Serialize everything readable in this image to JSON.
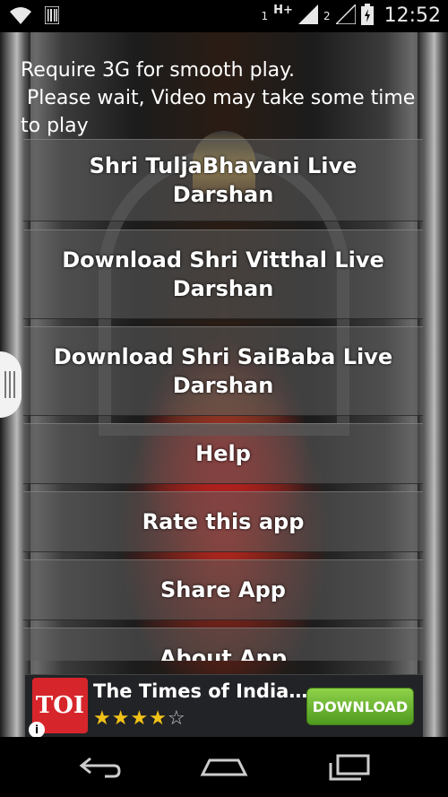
{
  "status_bar": {
    "sim1_label": "1",
    "network_type": "H+",
    "sim2_label": "2",
    "time": "12:52",
    "icons": [
      "wifi-icon",
      "barcode-icon",
      "signal-icon",
      "signal-icon",
      "battery-icon"
    ]
  },
  "notice": {
    "text": "Require 3G for smooth play.\n Please wait, Video may take some time to play"
  },
  "menu": {
    "items": [
      {
        "label": "Shri TuljaBhavani Live Darshan"
      },
      {
        "label": "Download Shri Vitthal Live Darshan"
      },
      {
        "label": "Download Shri SaiBaba Live Darshan"
      },
      {
        "label": "Help"
      },
      {
        "label": "Rate this app"
      },
      {
        "label": "Share App"
      },
      {
        "label": "About App"
      }
    ]
  },
  "ad": {
    "logo_text": "TOI",
    "title": "The Times of India…",
    "rating": 4,
    "rating_max": 5,
    "cta_label": "DOWNLOAD",
    "info_label": "i",
    "brand_color": "#d6262b"
  },
  "nav_bar": {
    "icons": [
      "back-icon",
      "home-icon",
      "recents-icon"
    ]
  }
}
